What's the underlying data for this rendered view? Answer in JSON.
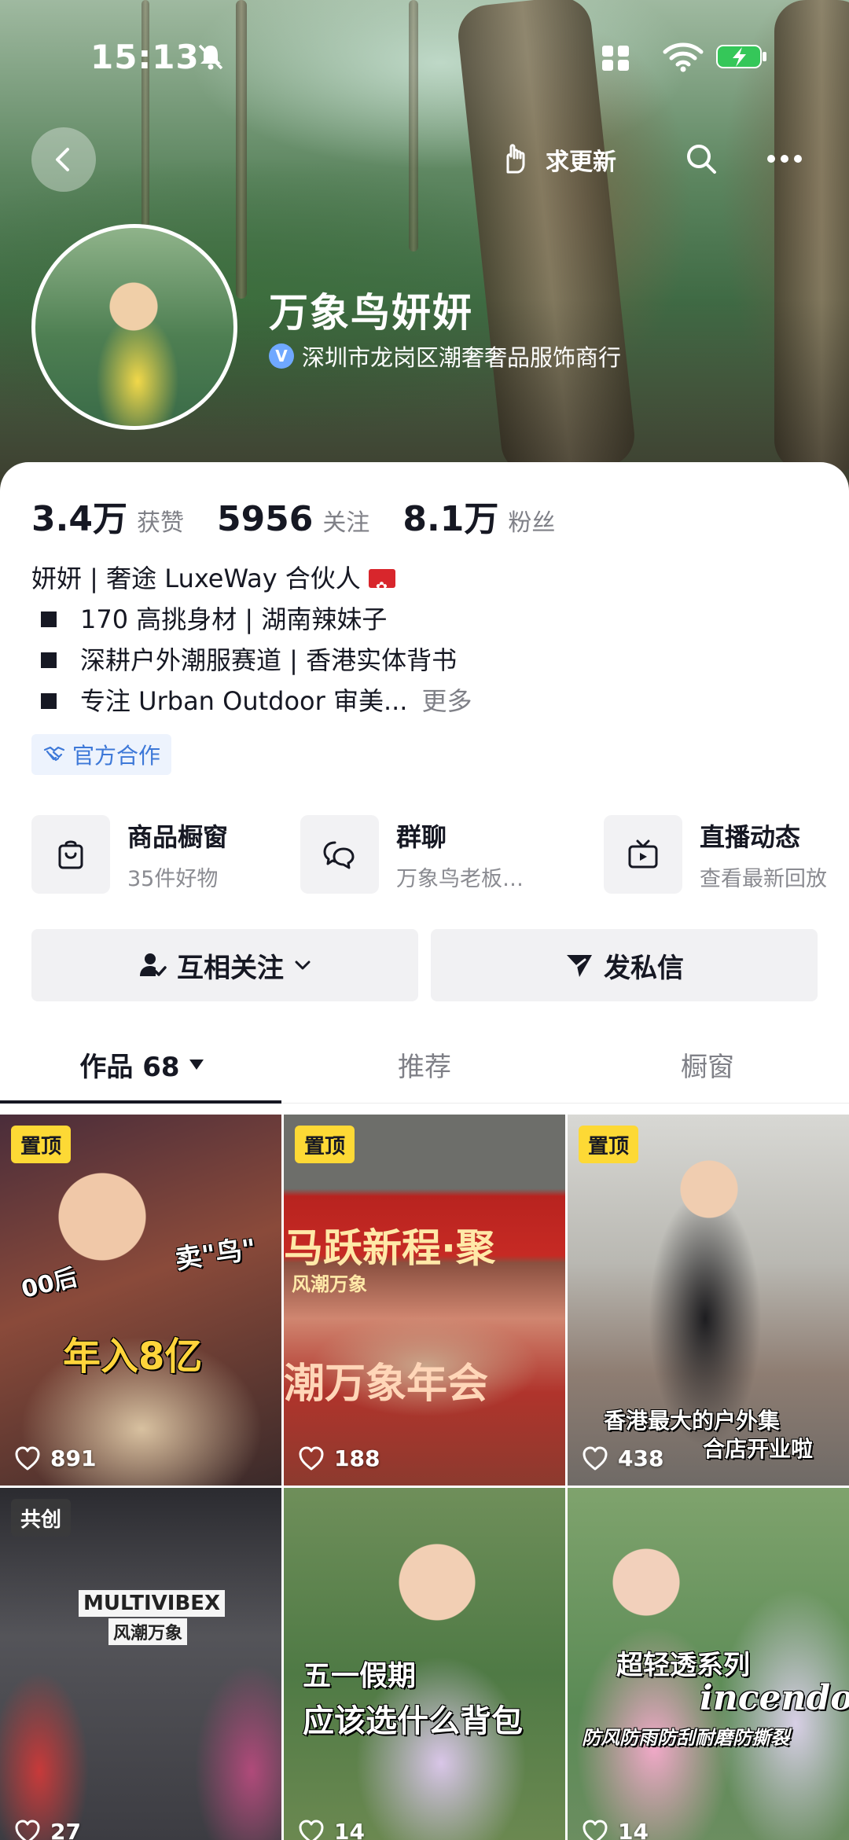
{
  "status_bar": {
    "time": "15:13"
  },
  "header": {
    "update_label": "求更新"
  },
  "profile": {
    "name": "万象鸟妍妍",
    "verification": "深圳市龙岗区潮奢奢品服饰商行"
  },
  "stats": [
    {
      "value": "3.4万",
      "label": "获赞"
    },
    {
      "value": "5956",
      "label": "关注"
    },
    {
      "value": "8.1万",
      "label": "粉丝"
    }
  ],
  "bio": {
    "line1": "妍妍 | 奢途 LuxeWay 合伙人",
    "line2": "170 高挑身材 | 湖南辣妹子",
    "line3": "深耕户外潮服赛道 | 香港实体背书",
    "line4": "专注 Urban Outdoor 审美...",
    "more": "更多"
  },
  "tag": {
    "label": "官方合作"
  },
  "entries": [
    {
      "title": "商品橱窗",
      "subtitle": "35件好物",
      "icon": "shopping-bag-icon"
    },
    {
      "title": "群聊",
      "subtitle": "万象鸟老板…",
      "icon": "chat-bubbles-icon"
    },
    {
      "title": "直播动态",
      "subtitle": "查看最新回放",
      "icon": "tv-icon"
    }
  ],
  "actions": {
    "follow": "互相关注",
    "message": "发私信"
  },
  "tabs": {
    "works": "作品 68",
    "recommend": "推荐",
    "showcase": "橱窗"
  },
  "videos": [
    {
      "badge": "置顶",
      "likes": "891",
      "captions": [
        "00后",
        "卖\"鸟\"",
        "年入8亿"
      ]
    },
    {
      "badge": "置顶",
      "likes": "188",
      "captions": [
        "马跃新程·聚",
        "风潮万象",
        "潮万象年会"
      ]
    },
    {
      "badge": "置顶",
      "likes": "438",
      "captions": [
        "香港最大的户外集",
        "合店开业啦"
      ]
    },
    {
      "badge": "共创",
      "likes": "27",
      "captions": [
        "MULTIVIBEX",
        "风潮万象"
      ]
    },
    {
      "badge": "",
      "likes": "14",
      "captions": [
        "五一假期",
        "应该选什么背包"
      ]
    },
    {
      "badge": "",
      "likes": "14",
      "captions": [
        "超轻透系列",
        "incendo",
        "防风防雨防刮耐磨防撕裂"
      ]
    }
  ],
  "colors": {
    "accent_badge": "#fdd935",
    "tag_blue": "#3d78d8",
    "text": "#161823",
    "muted": "#7f8087"
  }
}
